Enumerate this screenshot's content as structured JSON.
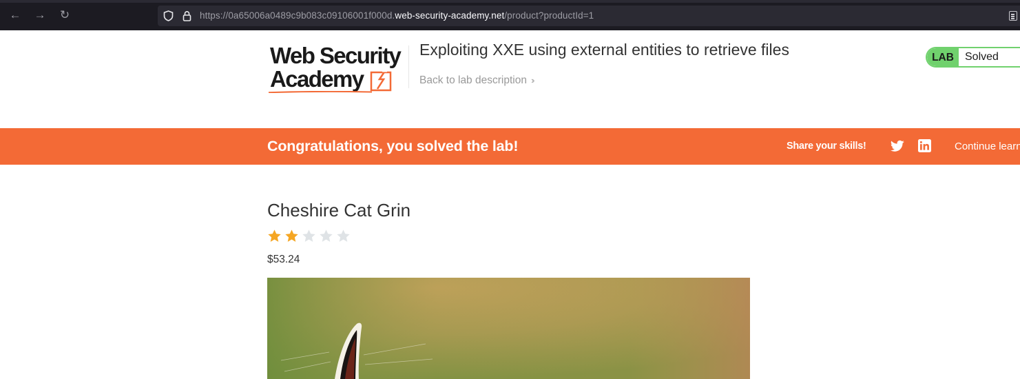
{
  "browser": {
    "url_prefix": "https://0a65006a0489c9b083c09106001f000d.",
    "url_domain": "web-security-academy.net",
    "url_path": "/product?productId=1"
  },
  "header": {
    "logo_line1": "Web Security",
    "logo_line2": "Academy",
    "lab_title": "Exploiting XXE using external entities to retrieve files",
    "back_link": "Back to lab description",
    "status_tag": "LAB",
    "status_text": "Solved"
  },
  "banner": {
    "message": "Congratulations, you solved the lab!",
    "share_label": "Share your skills!",
    "continue_label": "Continue learning"
  },
  "product": {
    "title": "Cheshire Cat Grin",
    "rating": 2,
    "rating_max": 5,
    "price": "$53.24"
  },
  "colors": {
    "brand_orange": "#f36a36",
    "status_green": "#70d16d",
    "star_filled": "#f5a623",
    "star_empty": "#dfe3e6"
  }
}
